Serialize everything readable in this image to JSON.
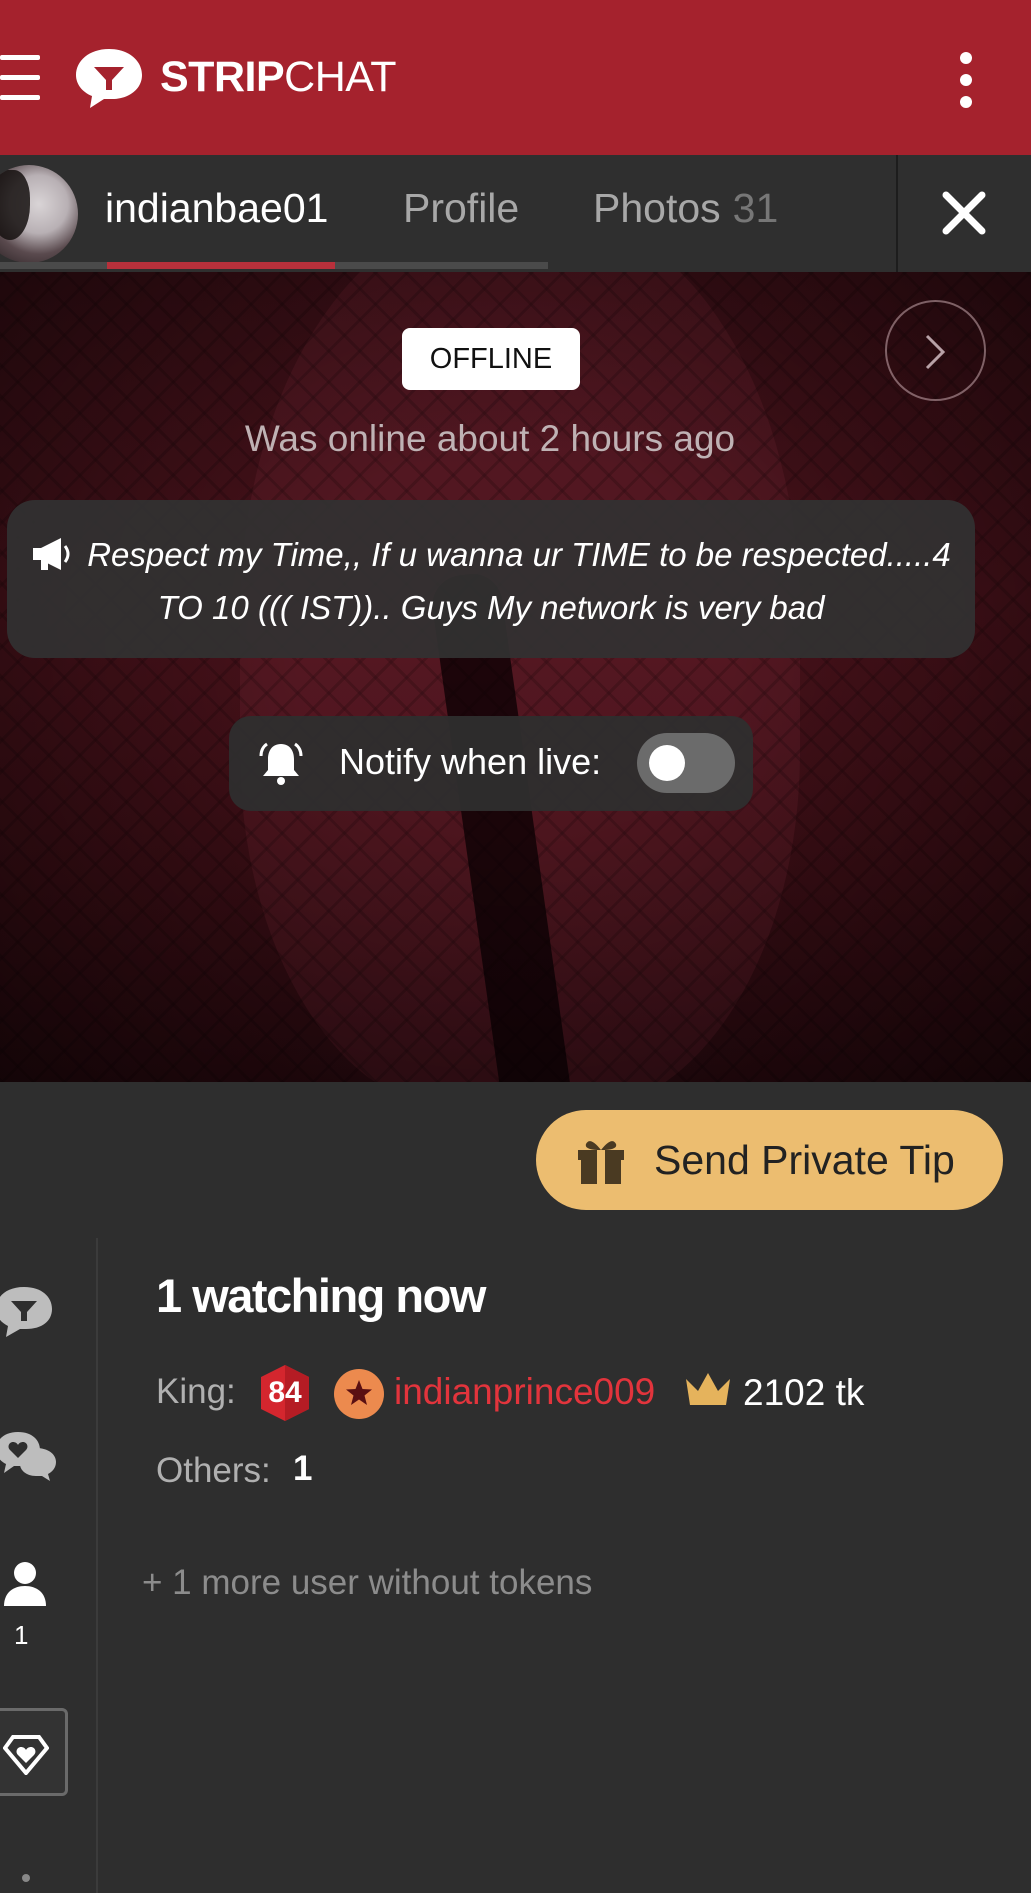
{
  "header": {
    "logo_bold": "STRIP",
    "logo_regular": "CHAT"
  },
  "tabs": [
    {
      "label": "indianbae01"
    },
    {
      "label": "Profile"
    },
    {
      "label": "Photos",
      "count": "31"
    }
  ],
  "hero": {
    "status_badge": "OFFLINE",
    "last_online": "Was online about 2 hours ago",
    "topic": "Respect my Time,, If u wanna ur TIME to be respected.....4 TO 10 ((( IST)).. Guys My network is very bad",
    "notify_label": "Notify when live:",
    "notify_enabled": false
  },
  "tip_button": {
    "label": "Send Private Tip"
  },
  "sidebar": {
    "users_count": "1"
  },
  "viewers": {
    "watching": "1 watching now",
    "king_label": "King:",
    "king_level": "84",
    "king_name": "indianprince009",
    "king_tokens": "2102 tk",
    "others_label": "Others:",
    "others_count": "1",
    "more_users": "+ 1 more user without tokens"
  },
  "colors": {
    "brand": "#a5222d",
    "tip_button": "#ecbd70",
    "king_name": "#e2343c",
    "background": "#2e2e2e"
  },
  "icons": [
    "menu-icon",
    "stripchat-logo-icon",
    "more-vertical-icon",
    "close-icon",
    "chevron-right-icon",
    "megaphone-icon",
    "bell-icon",
    "gift-icon",
    "chat-icon",
    "chat-hearts-icon",
    "user-icon",
    "diamond-heart-icon",
    "crown-icon",
    "star-icon"
  ]
}
